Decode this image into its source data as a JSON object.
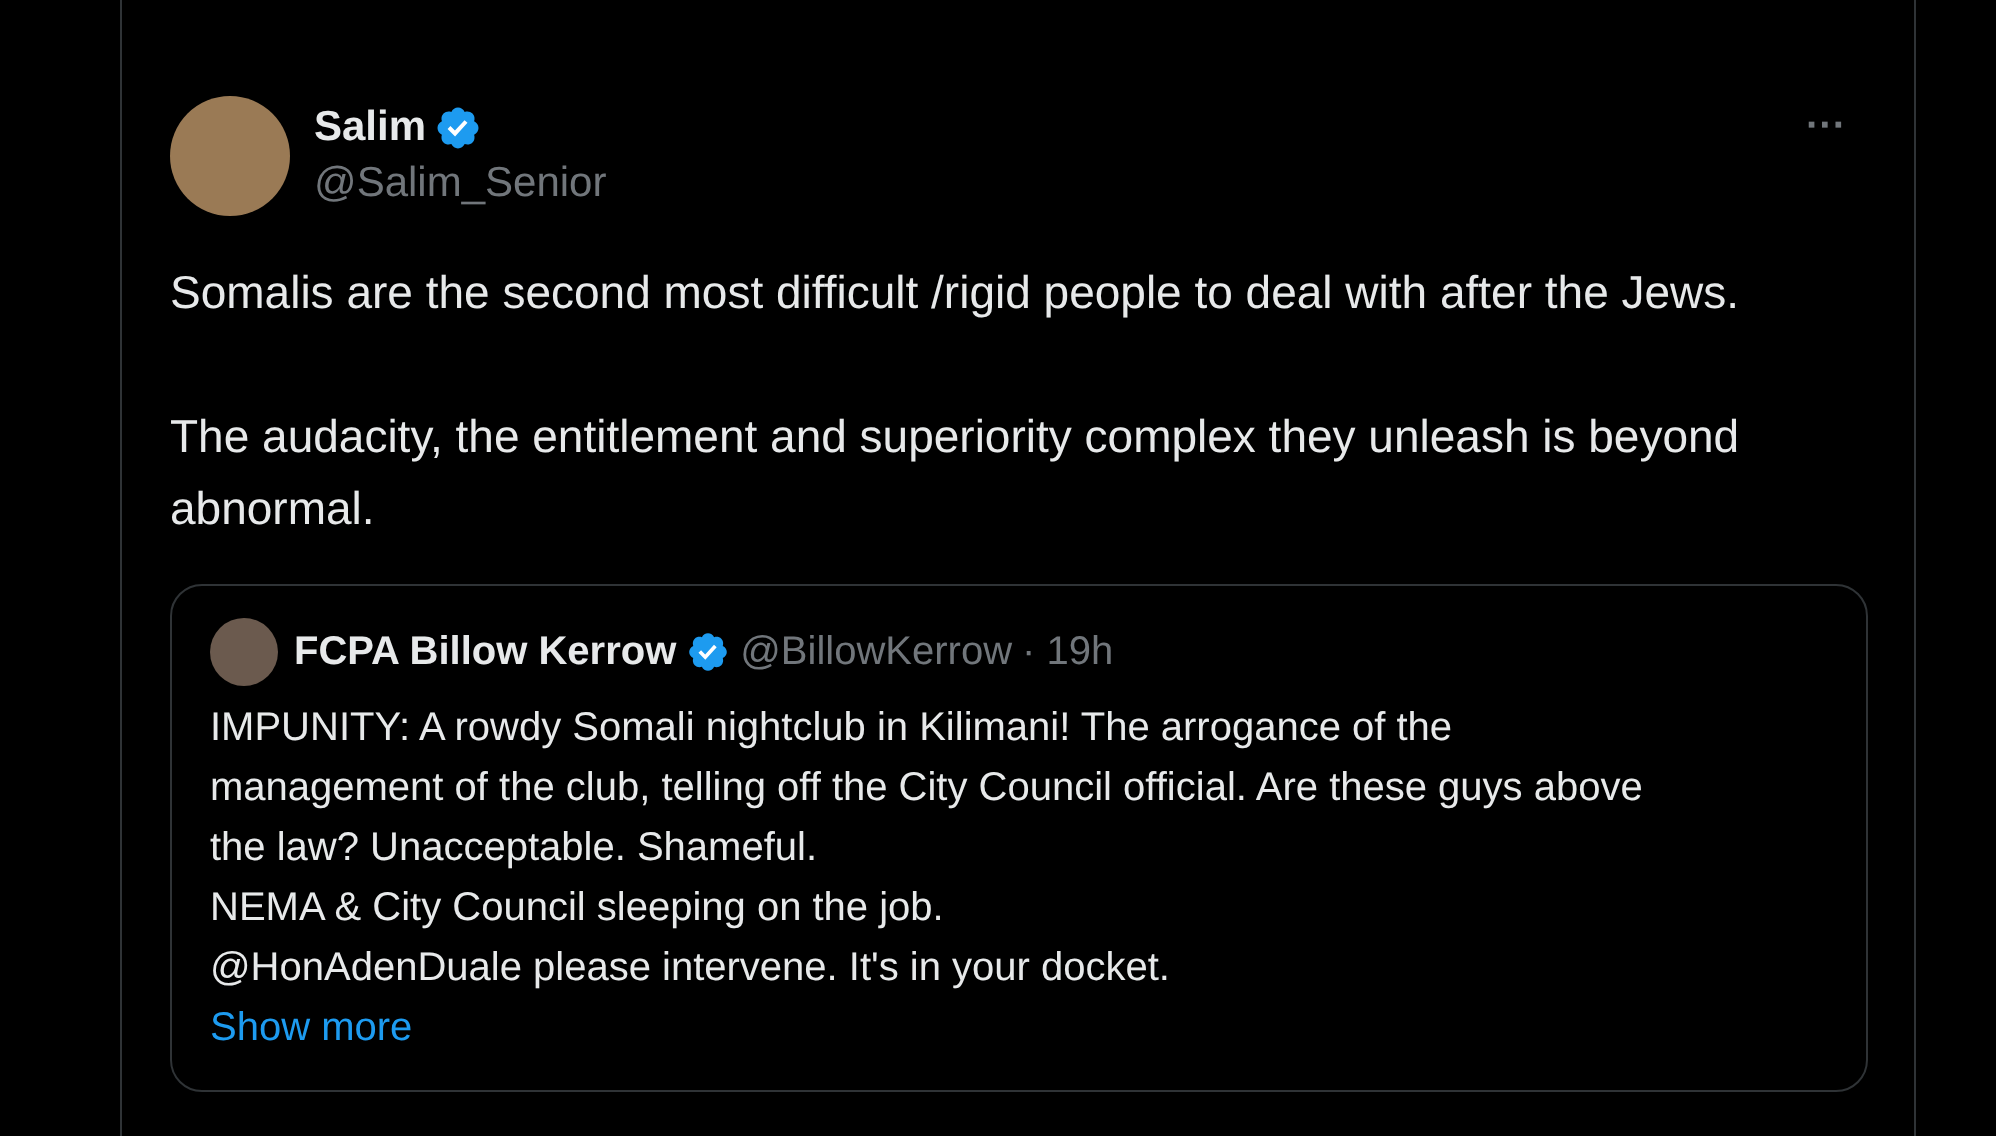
{
  "post": {
    "author": {
      "name": "Salim",
      "handle": "@Salim_Senior",
      "verified": true
    },
    "more": "···",
    "paragraphs": [
      "Somalis are the second most difficult /rigid people to deal with after the Jews.",
      "The audacity, the entitlement and superiority complex they unleash is beyond abnormal."
    ],
    "quote": {
      "author": {
        "name": "FCPA Billow Kerrow",
        "handle": "@BillowKerrow",
        "verified": true
      },
      "time": "· 19h",
      "lines": [
        "IMPUNITY: A rowdy Somali nightclub in Kilimani! The arrogance of the management of the club, telling off the City Council official. Are these guys above the law? Unacceptable. Shameful.",
        "NEMA & City Council sleeping on the job.",
        "@HonAdenDuale please intervene. It's in your docket."
      ],
      "show_more": "Show more"
    }
  }
}
